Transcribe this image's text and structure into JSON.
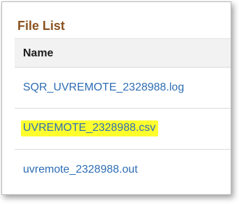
{
  "file_list": {
    "title": "File List",
    "column_header": "Name",
    "files": [
      {
        "name": "SQR_UVREMOTE_2328988.log",
        "highlighted": false
      },
      {
        "name": "UVREMOTE_2328988.csv",
        "highlighted": true
      },
      {
        "name": "uvremote_2328988.out",
        "highlighted": false
      }
    ]
  },
  "colors": {
    "title": "#8a5220",
    "link": "#2e6db4",
    "highlight": "#ffff2e",
    "header_bg": "#f2f2f2"
  }
}
